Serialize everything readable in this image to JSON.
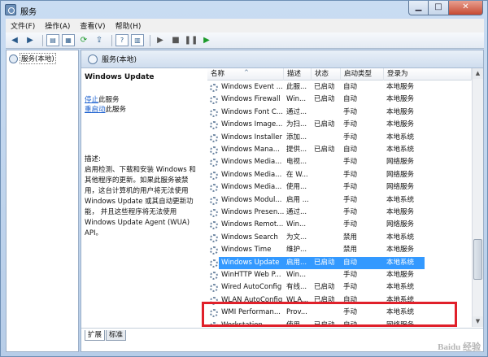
{
  "window": {
    "title": "服务",
    "buttons": {
      "minimize": "▁",
      "maximize": "□",
      "close": "✕"
    }
  },
  "menu": [
    {
      "label": "文件(F)"
    },
    {
      "label": "操作(A)"
    },
    {
      "label": "查看(V)"
    },
    {
      "label": "帮助(H)"
    }
  ],
  "toolbar": {
    "icons": [
      "back-arrow-icon",
      "forward-arrow-icon",
      "console-tree-icon",
      "properties-icon",
      "refresh-icon",
      "export-list-icon",
      "help-icon",
      "view-icon",
      "start-service-icon",
      "stop-service-icon",
      "pause-service-icon",
      "restart-service-icon"
    ]
  },
  "tree": {
    "item": "服务(本地)"
  },
  "main": {
    "header": "服务(本地)"
  },
  "description": {
    "title": "Windows Update",
    "actions": [
      {
        "link": "停止",
        "rest": "此服务"
      },
      {
        "link": "重启动",
        "rest": "此服务"
      }
    ],
    "label": "描述:",
    "lines": [
      "启用检测、下载和安装 Windows 和",
      "其他程序的更新。如果此服务被禁",
      "用，这台计算机的用户将无法使用",
      "Windows Update 或其自动更新功",
      "能， 并且这些程序将无法使用",
      "Windows Update Agent (WUA)",
      "API。"
    ]
  },
  "table": {
    "headers": {
      "name": "名称",
      "desc": "描述",
      "status": "状态",
      "start": "启动类型",
      "logon": "登录为"
    },
    "rows": [
      {
        "name": "Windows Event ...",
        "desc": "此服...",
        "status": "已启动",
        "start": "自动",
        "logon": "本地服务"
      },
      {
        "name": "Windows Firewall",
        "desc": "Win...",
        "status": "已启动",
        "start": "自动",
        "logon": "本地服务"
      },
      {
        "name": "Windows Font C...",
        "desc": "通过...",
        "status": "",
        "start": "手动",
        "logon": "本地服务"
      },
      {
        "name": "Windows Image...",
        "desc": "为扫...",
        "status": "已启动",
        "start": "手动",
        "logon": "本地服务"
      },
      {
        "name": "Windows Installer",
        "desc": "添加...",
        "status": "",
        "start": "手动",
        "logon": "本地系统"
      },
      {
        "name": "Windows Mana...",
        "desc": "提供...",
        "status": "已启动",
        "start": "自动",
        "logon": "本地系统"
      },
      {
        "name": "Windows Media...",
        "desc": "电视...",
        "status": "",
        "start": "手动",
        "logon": "网络服务"
      },
      {
        "name": "Windows Media...",
        "desc": "在 W...",
        "status": "",
        "start": "手动",
        "logon": "网络服务"
      },
      {
        "name": "Windows Media...",
        "desc": "使用...",
        "status": "",
        "start": "手动",
        "logon": "网络服务"
      },
      {
        "name": "Windows Modul...",
        "desc": "启用 ...",
        "status": "",
        "start": "手动",
        "logon": "本地系统"
      },
      {
        "name": "Windows Presen...",
        "desc": "通过...",
        "status": "",
        "start": "手动",
        "logon": "本地服务"
      },
      {
        "name": "Windows Remot...",
        "desc": "Win...",
        "status": "",
        "start": "手动",
        "logon": "网络服务"
      },
      {
        "name": "Windows Search",
        "desc": "为文...",
        "status": "",
        "start": "禁用",
        "logon": "本地系统"
      },
      {
        "name": "Windows Time",
        "desc": "维护...",
        "status": "",
        "start": "禁用",
        "logon": "本地服务"
      },
      {
        "name": "Windows Update",
        "desc": "启用...",
        "status": "已启动",
        "start": "自动",
        "logon": "本地系统",
        "selected": true
      },
      {
        "name": "WinHTTP Web P...",
        "desc": "Win...",
        "status": "",
        "start": "手动",
        "logon": "本地服务"
      },
      {
        "name": "Wired AutoConfig",
        "desc": "有线...",
        "status": "已启动",
        "start": "手动",
        "logon": "本地系统"
      },
      {
        "name": "WLAN AutoConfig",
        "desc": "WLA...",
        "status": "已启动",
        "start": "自动",
        "logon": "本地系统"
      },
      {
        "name": "WMI Performan...",
        "desc": "Prov...",
        "status": "",
        "start": "手动",
        "logon": "本地系统"
      },
      {
        "name": "Workstation",
        "desc": "使用 ...",
        "status": "已启动",
        "start": "自动",
        "logon": "网络服务"
      }
    ]
  },
  "tabs": [
    {
      "label": "扩展"
    },
    {
      "label": "标准"
    }
  ],
  "watermark": "Baidu 经验"
}
